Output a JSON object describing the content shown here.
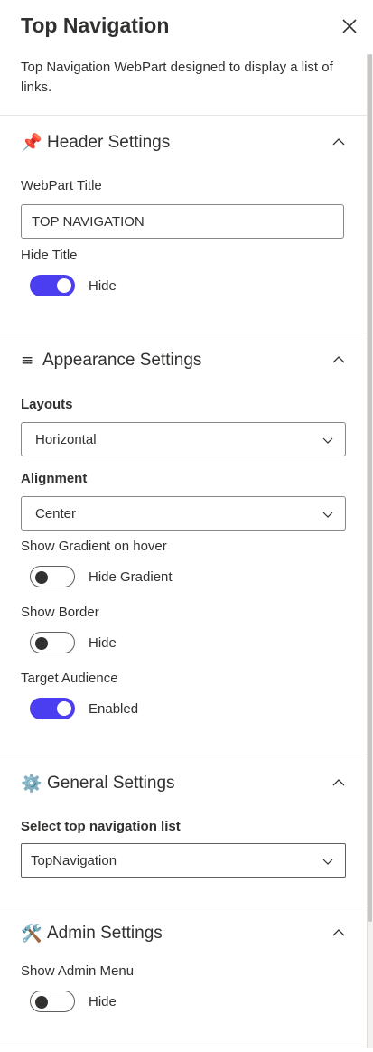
{
  "panel": {
    "title": "Top Navigation",
    "description": "Top Navigation WebPart designed to display a list of links."
  },
  "header_settings": {
    "icon": "📌",
    "title": "Header Settings",
    "webpart_title_label": "WebPart Title",
    "webpart_title_value": "TOP NAVIGATION",
    "hide_title_label": "Hide Title",
    "hide_title_state": "Hide",
    "hide_title_on": true
  },
  "appearance_settings": {
    "icon": "≡",
    "title": "Appearance Settings",
    "layouts_label": "Layouts",
    "layouts_value": "Horizontal",
    "alignment_label": "Alignment",
    "alignment_value": "Center",
    "gradient_label": "Show Gradient on hover",
    "gradient_state": "Hide Gradient",
    "gradient_on": false,
    "border_label": "Show Border",
    "border_state": "Hide",
    "border_on": false,
    "audience_label": "Target Audience",
    "audience_state": "Enabled",
    "audience_on": true
  },
  "general_settings": {
    "icon": "⚙️",
    "title": "General Settings",
    "list_label": "Select top navigation list",
    "list_value": "TopNavigation"
  },
  "admin_settings": {
    "icon": "🛠️",
    "title": "Admin Settings",
    "menu_label": "Show Admin Menu",
    "menu_state": "Hide",
    "menu_on": false
  },
  "colors": {
    "toggle_on": "#4b3df0",
    "text": "#323130",
    "border": "#8a8886"
  }
}
